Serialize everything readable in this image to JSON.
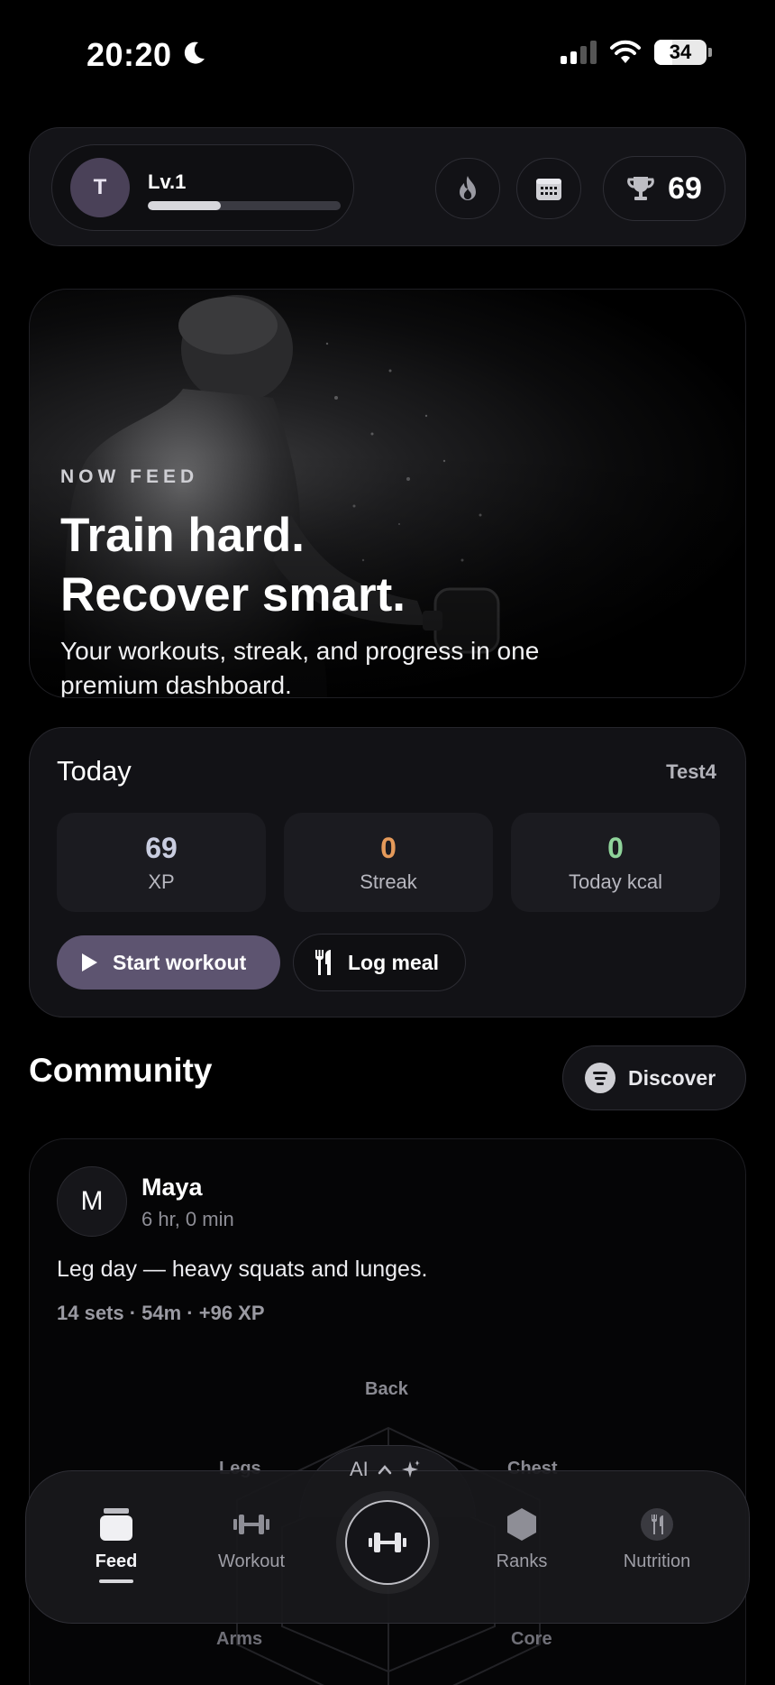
{
  "status_bar": {
    "time": "20:20",
    "battery": "34"
  },
  "top_bar": {
    "avatar_initial": "T",
    "level_label": "Lv.1",
    "level_progress": 0.38,
    "trophy_count": "69"
  },
  "hero": {
    "kicker": "NOW FEED",
    "title_line1": "Train hard.",
    "title_line2": "Recover smart.",
    "subtitle": "Your workouts, streak, and progress in one premium dashboard."
  },
  "today": {
    "title": "Today",
    "username": "Test4",
    "stats": [
      {
        "value": "69",
        "label": "XP",
        "color": "#c9cde0"
      },
      {
        "value": "0",
        "label": "Streak",
        "color": "#e59a5a"
      },
      {
        "value": "0",
        "label": "Today kcal",
        "color": "#8fd39a"
      }
    ],
    "start_workout_label": "Start workout",
    "log_meal_label": "Log meal"
  },
  "community": {
    "title": "Community",
    "discover_label": "Discover",
    "post": {
      "avatar_initial": "M",
      "name": "Maya",
      "time": "6 hr, 0 min",
      "text": "Leg day — heavy squats and lunges.",
      "stats": "14 sets · 54m · +96 XP",
      "radar_labels": {
        "back": "Back",
        "legs": "Legs",
        "chest": "Chest",
        "arms": "Arms",
        "core": "Core"
      }
    }
  },
  "bottom_nav": {
    "ai_label": "AI",
    "items": [
      {
        "label": "Feed",
        "icon": "feed-icon",
        "active": true
      },
      {
        "label": "Workout",
        "icon": "dumbbell-icon",
        "active": false
      },
      {
        "label": "Ranks",
        "icon": "hexagon-icon",
        "active": false
      },
      {
        "label": "Nutrition",
        "icon": "fork-knife-icon",
        "active": false
      }
    ]
  }
}
